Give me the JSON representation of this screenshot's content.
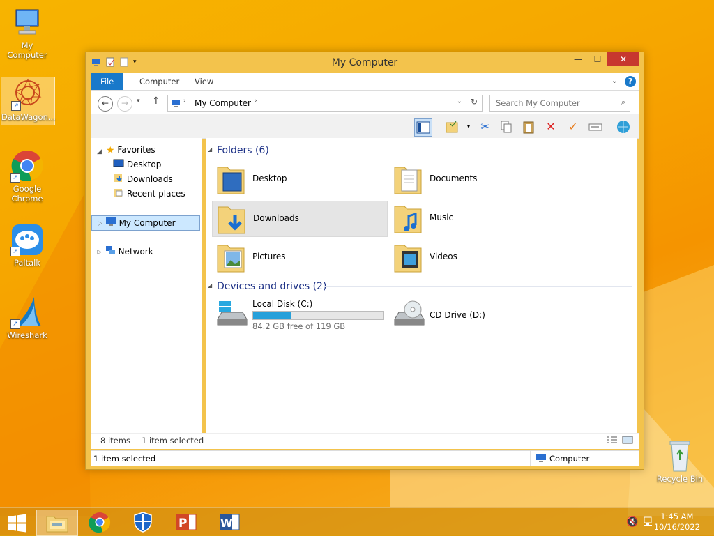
{
  "desktop": {
    "icons": [
      {
        "label": "My Computer"
      },
      {
        "label": "DataWagon..."
      },
      {
        "label": "Google Chrome"
      },
      {
        "label": "Paltalk"
      },
      {
        "label": "Wireshark"
      },
      {
        "label": "Recycle Bin"
      }
    ]
  },
  "window": {
    "title": "My Computer",
    "controls": {
      "minimize": "—",
      "maximize": "☐",
      "close": "✕"
    },
    "ribbon_tabs": [
      "File",
      "Computer",
      "View"
    ],
    "address": {
      "path": "My Computer",
      "search_placeholder": "Search My Computer"
    },
    "nav": {
      "favorites": "Favorites",
      "favorites_items": [
        "Desktop",
        "Downloads",
        "Recent places"
      ],
      "my_computer": "My Computer",
      "network": "Network"
    },
    "groups": {
      "folders_header": "Folders (6)",
      "folders": [
        "Desktop",
        "Documents",
        "Downloads",
        "Music",
        "Pictures",
        "Videos"
      ],
      "devices_header": "Devices and drives (2)",
      "drive_c": {
        "name": "Local Disk (C:)",
        "free_text": "84.2 GB free of 119 GB",
        "used_fraction": 0.292
      },
      "drive_d": {
        "name": "CD Drive (D:)"
      }
    },
    "status": {
      "items": "8 items",
      "selected": "1 item selected"
    },
    "details": {
      "selected": "1 item selected",
      "location": "Computer"
    }
  },
  "taskbar": {
    "time": "1:45 AM",
    "date": "10/16/2022"
  },
  "colors": {
    "accent": "#1979ca",
    "close": "#c7372f",
    "frame": "#f3c34c",
    "drive_bar": "#26a0da"
  }
}
